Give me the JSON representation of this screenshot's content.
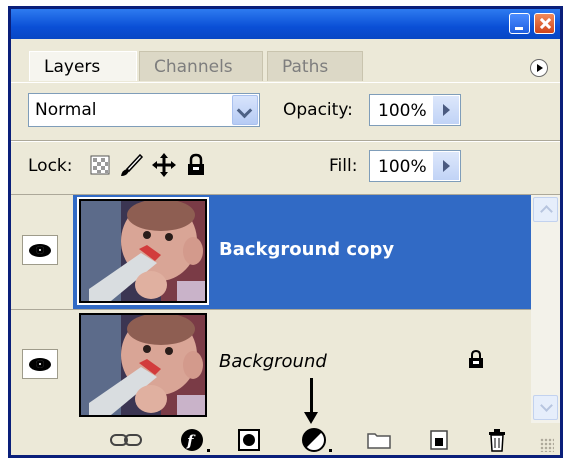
{
  "window": {
    "buttons": [
      "minimize",
      "close"
    ]
  },
  "tabs": [
    {
      "label": "Layers",
      "active": true
    },
    {
      "label": "Channels",
      "active": false
    },
    {
      "label": "Paths",
      "active": false
    }
  ],
  "panel_menu_icon": "circle-arrow-icon",
  "blend_mode": {
    "value": "Normal"
  },
  "opacity": {
    "label": "Opacity:",
    "value": "100%"
  },
  "lock": {
    "label": "Lock:",
    "icons": [
      "lock-transparent-icon",
      "lock-image-brush-icon",
      "lock-position-move-icon",
      "lock-all-padlock-icon"
    ]
  },
  "fill": {
    "label": "Fill:",
    "value": "100%"
  },
  "layers": [
    {
      "name": "Background copy",
      "selected": true,
      "visible": true,
      "locked": false
    },
    {
      "name": "Background",
      "selected": false,
      "visible": true,
      "locked": true
    }
  ],
  "bottom_toolbar": [
    "link-layers-icon",
    "layer-style-fx-icon",
    "add-mask-icon",
    "new-adjustment-layer-icon",
    "new-group-folder-icon",
    "new-layer-icon",
    "delete-trash-icon"
  ],
  "colors": {
    "selection": "#316ac5",
    "panel_bg": "#ece9d8",
    "titlebar": "#0a4fd6",
    "border": "#0a1f7a"
  },
  "annotation": {
    "type": "arrow",
    "points_to": "new-adjustment-layer-icon"
  }
}
